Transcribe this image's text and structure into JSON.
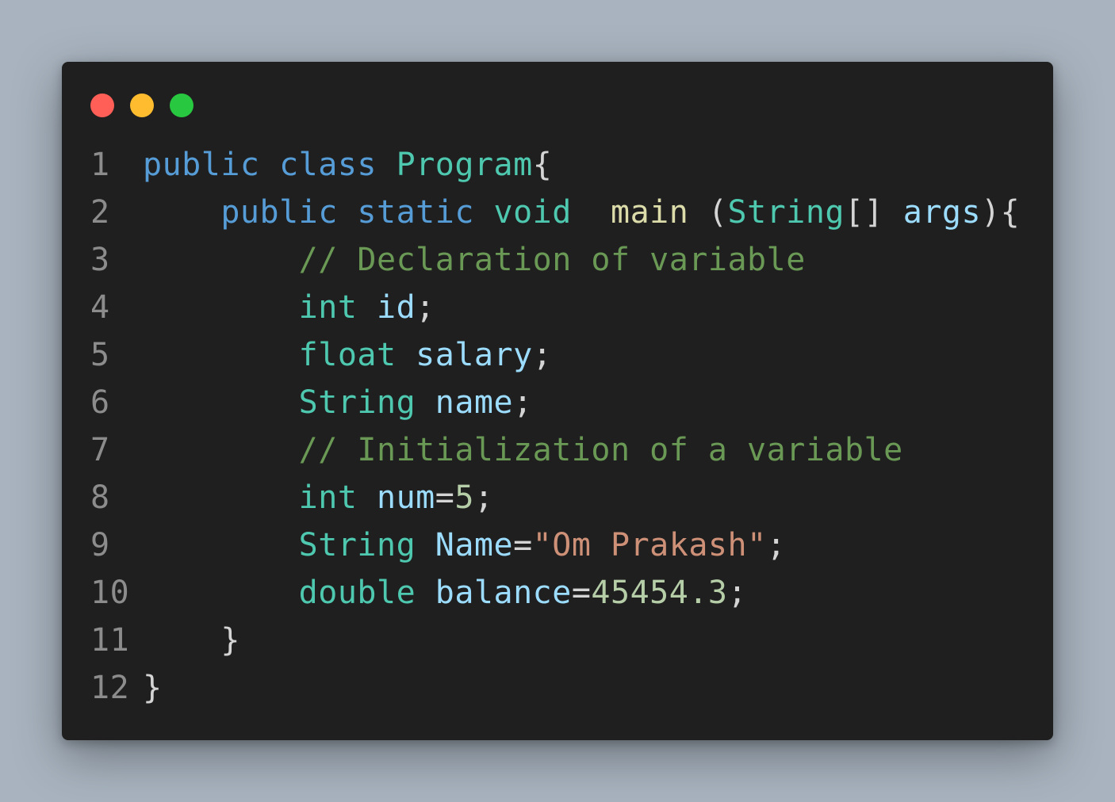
{
  "window": {
    "traffic_lights": [
      "close",
      "minimize",
      "maximize"
    ],
    "colors": {
      "background": "#1f1f1f",
      "close": "#ff5f57",
      "minimize": "#febc2e",
      "maximize": "#28c840"
    }
  },
  "code": {
    "language": "Java",
    "lines": [
      {
        "number": "1",
        "tokens": [
          {
            "t": "public",
            "c": "kw"
          },
          {
            "t": " ",
            "c": "pn"
          },
          {
            "t": "class",
            "c": "kw"
          },
          {
            "t": " ",
            "c": "pn"
          },
          {
            "t": "Program",
            "c": "ty"
          },
          {
            "t": "{",
            "c": "pn"
          }
        ]
      },
      {
        "number": "2",
        "tokens": [
          {
            "t": "    ",
            "c": "pn"
          },
          {
            "t": "public",
            "c": "kw"
          },
          {
            "t": " ",
            "c": "pn"
          },
          {
            "t": "static",
            "c": "kw"
          },
          {
            "t": " ",
            "c": "pn"
          },
          {
            "t": "void",
            "c": "ty"
          },
          {
            "t": "  ",
            "c": "pn"
          },
          {
            "t": "main",
            "c": "fn"
          },
          {
            "t": " (",
            "c": "pn"
          },
          {
            "t": "String",
            "c": "ty"
          },
          {
            "t": "[] ",
            "c": "pn"
          },
          {
            "t": "args",
            "c": "var"
          },
          {
            "t": "){",
            "c": "pn"
          }
        ]
      },
      {
        "number": "3",
        "tokens": [
          {
            "t": "        ",
            "c": "pn"
          },
          {
            "t": "// Declaration of variable",
            "c": "cm"
          }
        ]
      },
      {
        "number": "4",
        "tokens": [
          {
            "t": "        ",
            "c": "pn"
          },
          {
            "t": "int",
            "c": "ty"
          },
          {
            "t": " ",
            "c": "pn"
          },
          {
            "t": "id",
            "c": "var"
          },
          {
            "t": ";",
            "c": "pn"
          }
        ]
      },
      {
        "number": "5",
        "tokens": [
          {
            "t": "        ",
            "c": "pn"
          },
          {
            "t": "float",
            "c": "ty"
          },
          {
            "t": " ",
            "c": "pn"
          },
          {
            "t": "salary",
            "c": "var"
          },
          {
            "t": ";",
            "c": "pn"
          }
        ]
      },
      {
        "number": "6",
        "tokens": [
          {
            "t": "        ",
            "c": "pn"
          },
          {
            "t": "String",
            "c": "ty"
          },
          {
            "t": " ",
            "c": "pn"
          },
          {
            "t": "name",
            "c": "var"
          },
          {
            "t": ";",
            "c": "pn"
          }
        ]
      },
      {
        "number": "7",
        "tokens": [
          {
            "t": "        ",
            "c": "pn"
          },
          {
            "t": "// Initialization of a variable",
            "c": "cm"
          }
        ]
      },
      {
        "number": "8",
        "tokens": [
          {
            "t": "        ",
            "c": "pn"
          },
          {
            "t": "int",
            "c": "ty"
          },
          {
            "t": " ",
            "c": "pn"
          },
          {
            "t": "num",
            "c": "var"
          },
          {
            "t": "=",
            "c": "pn"
          },
          {
            "t": "5",
            "c": "num"
          },
          {
            "t": ";",
            "c": "pn"
          }
        ]
      },
      {
        "number": "9",
        "tokens": [
          {
            "t": "        ",
            "c": "pn"
          },
          {
            "t": "String",
            "c": "ty"
          },
          {
            "t": " ",
            "c": "pn"
          },
          {
            "t": "Name",
            "c": "var"
          },
          {
            "t": "=",
            "c": "pn"
          },
          {
            "t": "\"Om Prakash\"",
            "c": "str"
          },
          {
            "t": ";",
            "c": "pn"
          }
        ]
      },
      {
        "number": "10",
        "tokens": [
          {
            "t": "        ",
            "c": "pn"
          },
          {
            "t": "double",
            "c": "ty"
          },
          {
            "t": " ",
            "c": "pn"
          },
          {
            "t": "balance",
            "c": "var"
          },
          {
            "t": "=",
            "c": "pn"
          },
          {
            "t": "45454.3",
            "c": "num"
          },
          {
            "t": ";",
            "c": "pn"
          }
        ]
      },
      {
        "number": "11",
        "tokens": [
          {
            "t": "    ",
            "c": "pn"
          },
          {
            "t": "}",
            "c": "pn"
          }
        ]
      },
      {
        "number": "12",
        "tokens": [
          {
            "t": "}",
            "c": "pn"
          }
        ]
      }
    ]
  }
}
